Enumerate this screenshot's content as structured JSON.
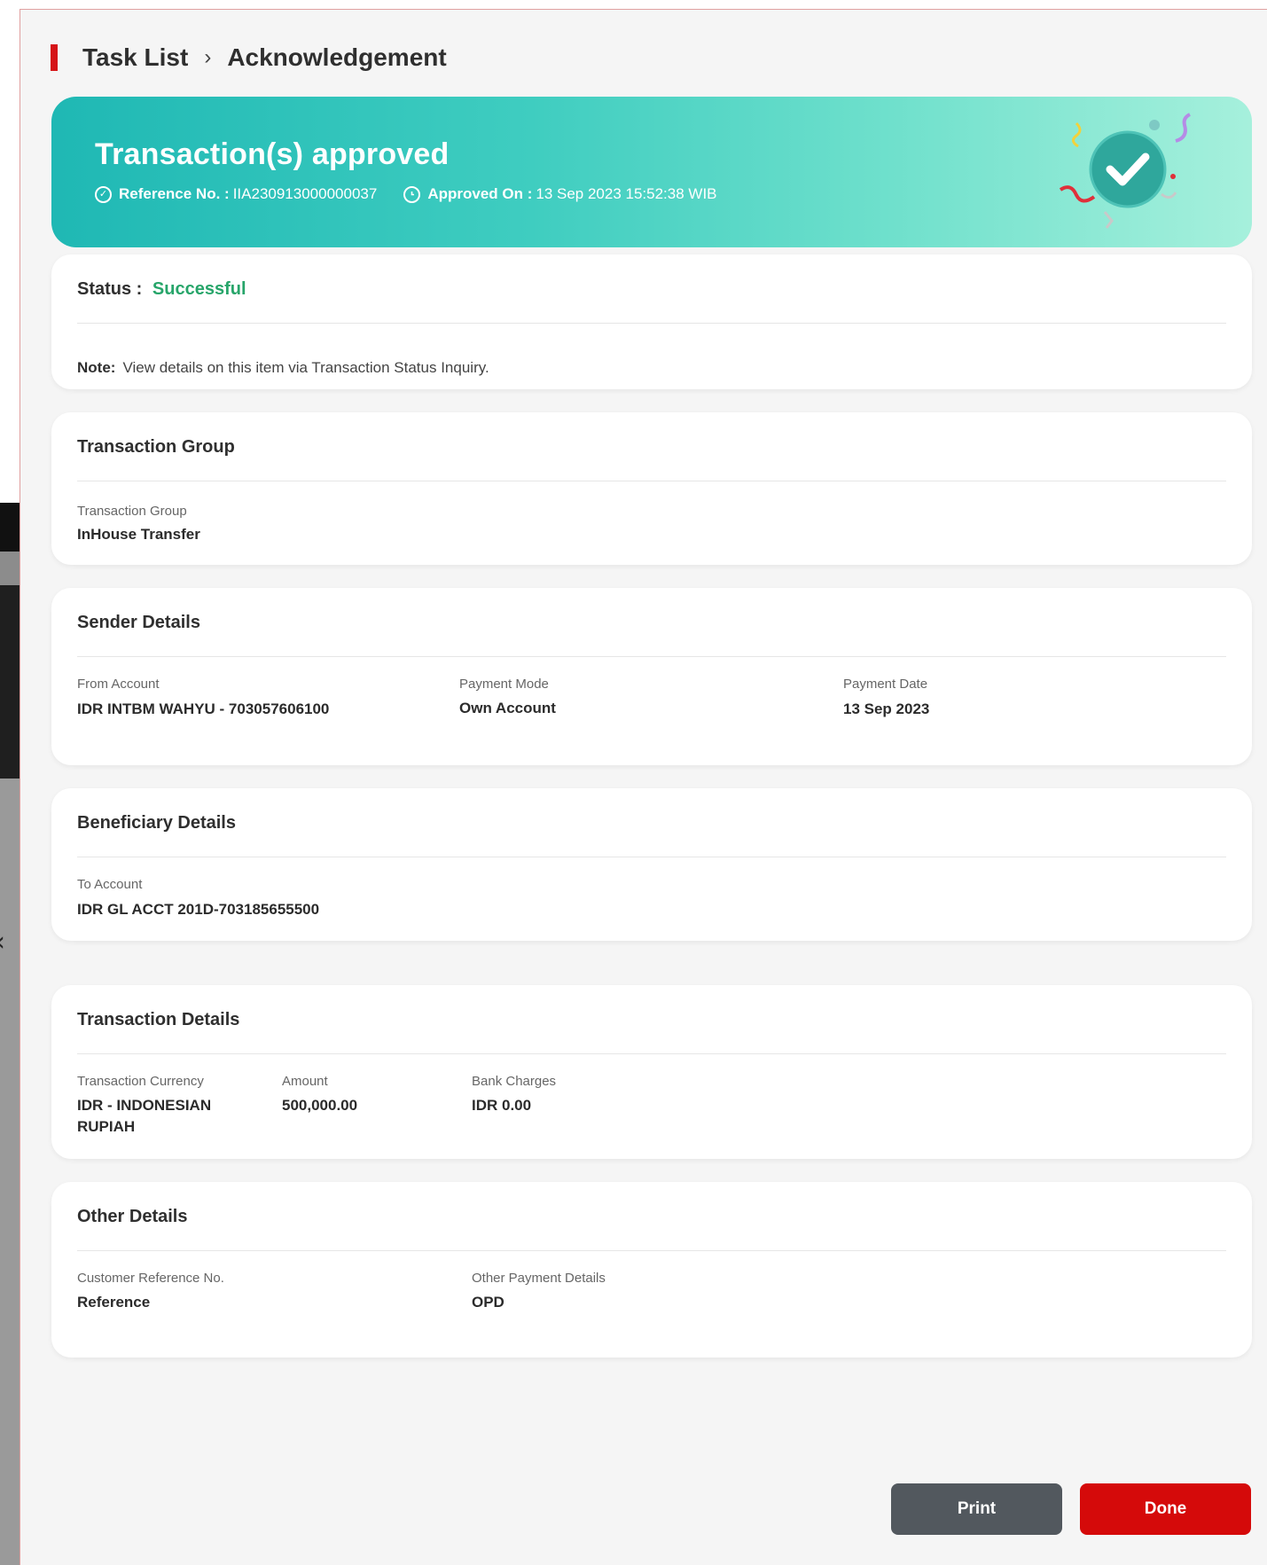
{
  "breadcrumb": {
    "parent": "Task List",
    "separator": "›",
    "current": "Acknowledgement"
  },
  "hero": {
    "title": "Transaction(s) approved",
    "reference_label": "Reference No. :",
    "reference_value": "IIA230913000000037",
    "approved_label": "Approved On :",
    "approved_value": "13 Sep 2023 15:52:38 WIB"
  },
  "status_card": {
    "status_label": "Status :",
    "status_value": "Successful",
    "note_label": "Note:",
    "note_text": "View details on this item via Transaction Status Inquiry."
  },
  "transaction_group": {
    "heading": "Transaction Group",
    "label": "Transaction Group",
    "value": "InHouse Transfer"
  },
  "sender_details": {
    "heading": "Sender Details",
    "from_account_label": "From Account",
    "from_account_value": "IDR INTBM WAHYU - 703057606100",
    "payment_mode_label": "Payment Mode",
    "payment_mode_value": "Own Account",
    "payment_date_label": "Payment Date",
    "payment_date_value": "13 Sep 2023"
  },
  "beneficiary_details": {
    "heading": "Beneficiary Details",
    "to_account_label": "To Account",
    "to_account_value": "IDR GL ACCT 201D-703185655500"
  },
  "transaction_details": {
    "heading": "Transaction Details",
    "currency_label": "Transaction Currency",
    "currency_value_line1": "IDR - INDONESIAN",
    "currency_value_line2": "RUPIAH",
    "amount_label": "Amount",
    "amount_value": "500,000.00",
    "charges_label": "Bank Charges",
    "charges_value": "IDR 0.00"
  },
  "other_details": {
    "heading": "Other Details",
    "customer_ref_label": "Customer Reference No.",
    "customer_ref_value": "Reference",
    "other_payment_label": "Other Payment Details",
    "other_payment_value": "OPD"
  },
  "actions": {
    "print_label": "Print",
    "done_label": "Done"
  },
  "colors": {
    "brand_red": "#d51317",
    "success_green": "#27a56a",
    "hero_start": "#1fb8b4",
    "hero_end": "#a6f0dc",
    "print_button": "#52585e",
    "done_button": "#d50a0a"
  },
  "icons": {
    "reference_icon": "check-circle-icon",
    "approved_icon": "clock-icon",
    "hero_illustration": "success-check-illustration",
    "back_chevron": "chevron-left-icon"
  }
}
